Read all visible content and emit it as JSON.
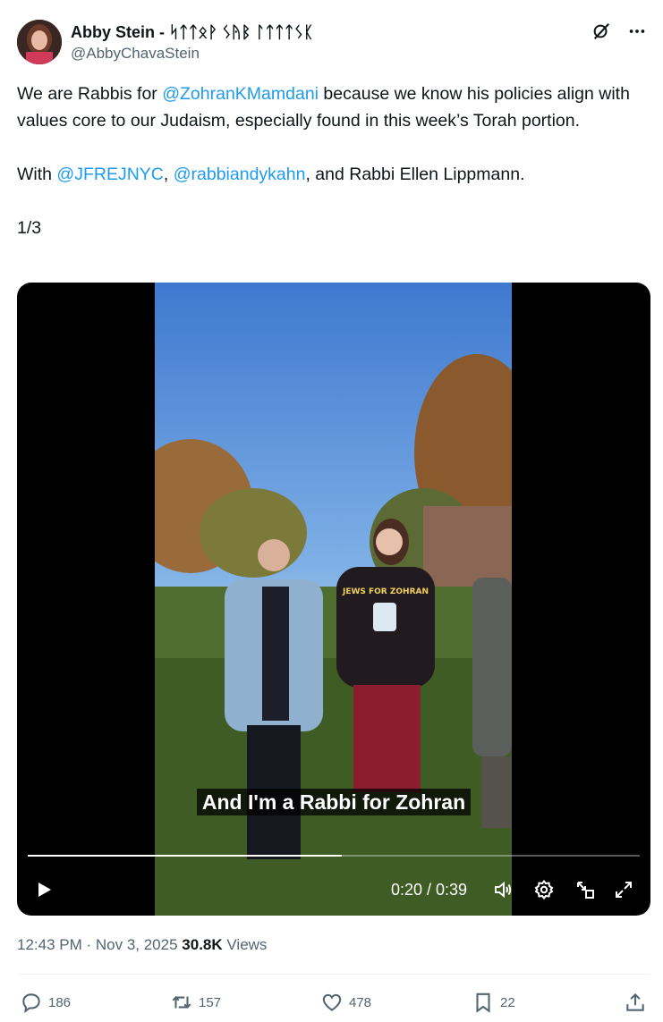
{
  "author": {
    "display_name": "Abby Stein - ᛋᛏᛏᛟᚹ ᛊᚤᛒ ᛚᛏᛏᛏᛊᛕ",
    "handle": "@AbbyChavaStein"
  },
  "tweet": {
    "line1_prefix": "We are Rabbis for ",
    "mention_zohran": "@ZohranKMamdani",
    "line1_suffix": " because we know his policies align with values core to our Judaism, especially found in this week’s Torah portion.",
    "line2_prefix": "With ",
    "mention_jfrej": "@JFREJNYC",
    "sep": ", ",
    "mention_andy": "@rabbiandykahn",
    "line2_suffix": ", and Rabbi Ellen Lippmann.",
    "thread_count": "1/3"
  },
  "video": {
    "caption": "And I'm a Rabbi for Zohran",
    "time_display": "0:20 / 0:39",
    "progress_fraction": 0.513,
    "shirt_text": "JEWS FOR ZOHRAN"
  },
  "meta": {
    "time": "12:43 PM",
    "dot": " · ",
    "date": "Nov 3, 2025",
    "views_count": "30.8K",
    "views_label": " Views"
  },
  "actions": {
    "replies": "186",
    "reposts": "157",
    "likes": "478",
    "bookmarks": "22"
  },
  "colors": {
    "link": "#1d9bf0",
    "secondary_text": "#536471",
    "primary_text": "#0f1419"
  },
  "icons": [
    "grok-icon",
    "more-icon",
    "play-icon",
    "volume-icon",
    "settings-icon",
    "pip-icon",
    "fullscreen-icon",
    "reply-icon",
    "repost-icon",
    "like-icon",
    "bookmark-icon",
    "share-icon"
  ]
}
